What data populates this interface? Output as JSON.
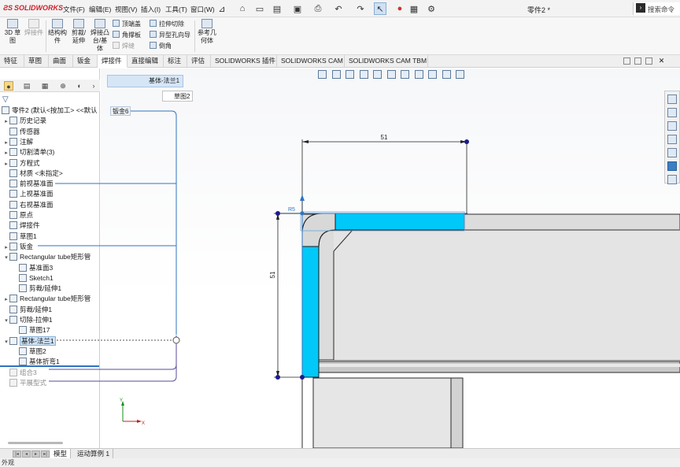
{
  "app": {
    "brand": "SOLIDWORKS",
    "doc_title": "零件2 *",
    "menus": [
      "文件(F)",
      "编辑(E)",
      "视图(V)",
      "插入(I)",
      "工具(T)",
      "窗口(W)"
    ],
    "search_placeholder": "搜索命令"
  },
  "command_manager": {
    "sketch3d": "3D 草图",
    "weld_sketch": "焊接件",
    "structure": "结构构件",
    "trim_extend": "剪裁/延伸",
    "boss_base": "焊接凸台/基体",
    "end_cap": "顶端盖",
    "gusset": "角撑板",
    "weld_bead": "焊缝",
    "extrude_cut": "拉伸切除",
    "hole_wizard": "异型孔向导",
    "chamfer": "倒角",
    "ref_geometry": "参考几何体"
  },
  "tabs": [
    "特征",
    "草图",
    "曲面",
    "钣金",
    "焊接件",
    "直接编辑",
    "标注",
    "评估",
    "SOLIDWORKS 插件",
    "SOLIDWORKS CAM",
    "SOLIDWORKS CAM TBM"
  ],
  "active_tab_index": 4,
  "tree": {
    "root": "零件2 (默认<按加工> <<默认",
    "items": [
      {
        "label": "历史记录",
        "exp": "▸",
        "indent": 1
      },
      {
        "label": "传感器",
        "exp": "",
        "indent": 1
      },
      {
        "label": "注解",
        "exp": "▸",
        "indent": 1
      },
      {
        "label": "切割清单(3)",
        "exp": "▸",
        "indent": 1
      },
      {
        "label": "方程式",
        "exp": "▸",
        "indent": 1
      },
      {
        "label": "材质 <未指定>",
        "exp": "",
        "indent": 1
      },
      {
        "label": "前视基准面",
        "exp": "",
        "indent": 1
      },
      {
        "label": "上视基准面",
        "exp": "",
        "indent": 1
      },
      {
        "label": "右视基准面",
        "exp": "",
        "indent": 1
      },
      {
        "label": "原点",
        "exp": "",
        "indent": 1
      },
      {
        "label": "焊接件",
        "exp": "",
        "indent": 1
      },
      {
        "label": "草图1",
        "exp": "",
        "indent": 1
      },
      {
        "label": "钣金",
        "exp": "▸",
        "indent": 1
      },
      {
        "label": "Rectangular tube矩形管",
        "exp": "▾",
        "indent": 1
      },
      {
        "label": "基准面3",
        "exp": "",
        "indent": 2
      },
      {
        "label": "Sketch1",
        "exp": "",
        "indent": 2
      },
      {
        "label": "剪裁/延伸1",
        "exp": "",
        "indent": 2
      },
      {
        "label": "Rectangular tube矩形管",
        "exp": "▸",
        "indent": 1
      },
      {
        "label": "剪裁/延伸1",
        "exp": "",
        "indent": 1
      },
      {
        "label": "切除-拉伸1",
        "exp": "▾",
        "indent": 1
      },
      {
        "label": "草图17",
        "exp": "",
        "indent": 2
      },
      {
        "label": "基体-法兰1",
        "exp": "▾",
        "indent": 1,
        "selected": true
      },
      {
        "label": "草图2",
        "exp": "",
        "indent": 2
      },
      {
        "label": "基体折弯1",
        "exp": "",
        "indent": 2
      },
      {
        "label": "组合3",
        "exp": "",
        "indent": 1,
        "greyed": true
      },
      {
        "label": "平展型式",
        "exp": "",
        "indent": 1,
        "greyed": true
      }
    ],
    "callout": "钣金6"
  },
  "graphics": {
    "breadcrumb": "基体-法兰1",
    "breadcrumb_sub": "草图2",
    "dim_horizontal": "51",
    "dim_vertical": "51",
    "dim_radius": "R5"
  },
  "bottom_tabs": [
    "模型",
    "运动算例 1"
  ],
  "status": "外观",
  "colors": {
    "flange_fill": "#00c8f8",
    "selection_blue": "#2f74c0",
    "dim_point": "#1c1c8c"
  }
}
